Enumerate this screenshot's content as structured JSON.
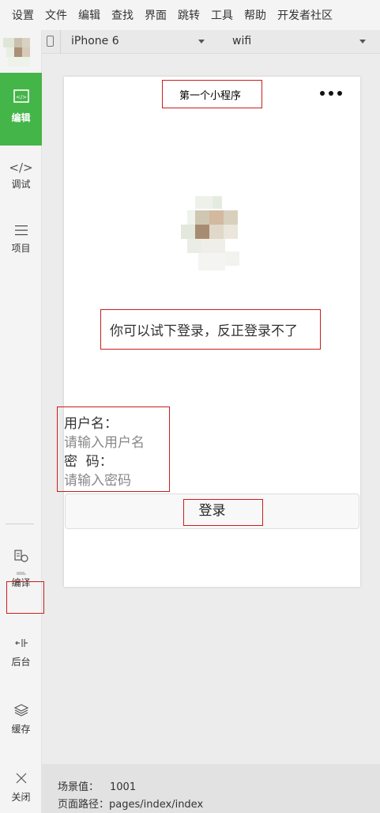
{
  "menu": [
    "设置",
    "文件",
    "编辑",
    "查找",
    "界面",
    "跳转",
    "工具",
    "帮助",
    "开发者社区"
  ],
  "sidebar": {
    "items": [
      {
        "label": "编辑",
        "icon": "code-box-icon"
      },
      {
        "label": "调试",
        "icon": "code-icon"
      },
      {
        "label": "项目",
        "icon": "menu-icon"
      },
      {
        "label": "编译",
        "icon": "compile-icon"
      },
      {
        "label": "后台",
        "icon": "background-icon"
      },
      {
        "label": "缓存",
        "icon": "layers-icon"
      },
      {
        "label": "关闭",
        "icon": "close-icon"
      }
    ]
  },
  "device_bar": {
    "device": "iPhone 6",
    "network": "wifi"
  },
  "page": {
    "nav_title": "第一个小程序",
    "notice": "你可以试下登录，反正登录不了",
    "username_label": "用户名：",
    "username_placeholder": "请输入用户名",
    "password_label": "密  码：",
    "password_placeholder": "请输入密码",
    "login_button": "登录"
  },
  "status": {
    "scene_label": "场景值：",
    "scene_value": "1001",
    "path_label": "页面路径：",
    "path_value": "pages/index/index"
  },
  "colors": {
    "accent": "#44b549",
    "highlight_box": "#c81e1e"
  }
}
